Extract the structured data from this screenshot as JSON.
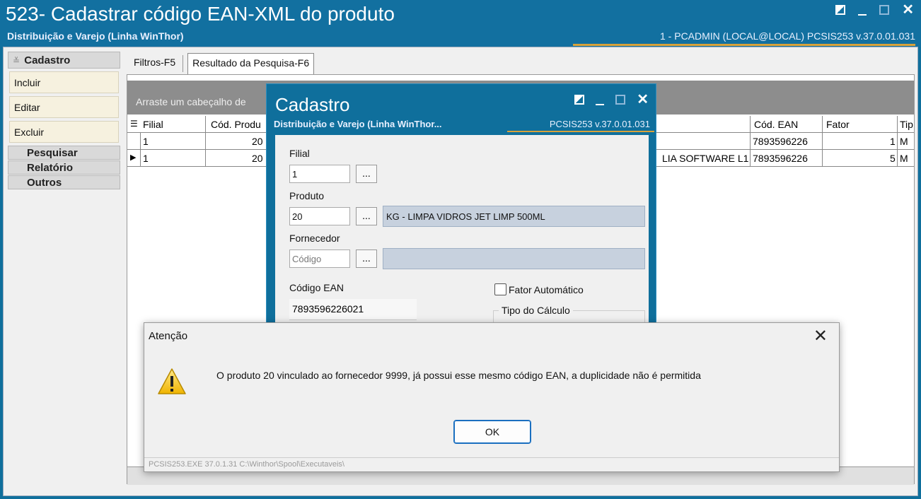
{
  "main_window": {
    "title": "523- Cadastrar código EAN-XML do produto",
    "subtitle": "Distribuição e Varejo (Linha WinThor)",
    "user_info": "1 - PCADMIN (LOCAL@LOCAL)   PCSIS253  v.37.0.01.031"
  },
  "sidebar": {
    "header": "Cadastro",
    "items": [
      "Incluir",
      "Editar",
      "Excluir"
    ],
    "groups": [
      "Pesquisar",
      "Relatório",
      "Outros"
    ]
  },
  "tabs": [
    "Filtros-F5",
    "Resultado da Pesquisa-F6"
  ],
  "grid": {
    "groupby_hint": "Arraste um cabeçalho de",
    "columns_left": [
      "Filial",
      "Cód. Produ"
    ],
    "columns_right": [
      "Cód. EAN",
      "Fator",
      "Tip"
    ],
    "rows": [
      {
        "filial": "1",
        "cod_produto": "20",
        "fornecedor": "",
        "cod_ean": "7893596226",
        "fator": "1",
        "tipo": "M"
      },
      {
        "filial": "1",
        "cod_produto": "20",
        "fornecedor": "LIA SOFTWARE L1",
        "cod_ean": "7893596226",
        "fator": "5",
        "tipo": "M"
      }
    ]
  },
  "cadastro_dialog": {
    "title": "Cadastro",
    "subtitle": "Distribuição e Varejo (Linha WinThor...",
    "version": "PCSIS253  v.37.0.01.031",
    "filial_label": "Filial",
    "filial_value": "1",
    "produto_label": "Produto",
    "produto_value": "20",
    "produto_desc": "KG - LIMPA VIDROS JET LIMP 500ML",
    "fornecedor_label": "Fornecedor",
    "fornecedor_placeholder": "Código",
    "dots": "...",
    "ean_label": "Código EAN",
    "ean_value": "7893596226021",
    "fator_auto_label": "Fator Automático",
    "tipo_calculo_label": "Tipo do Cálculo"
  },
  "alert": {
    "title": "Atenção",
    "message": "O produto 20 vinculado ao fornecedor 9999, já possui esse mesmo código EAN, a duplicidade não é permitida",
    "ok_label": "OK",
    "status": "PCSIS253.EXE 37.0.1.31 C:\\Winthor\\Spool\\Executaveis\\"
  }
}
